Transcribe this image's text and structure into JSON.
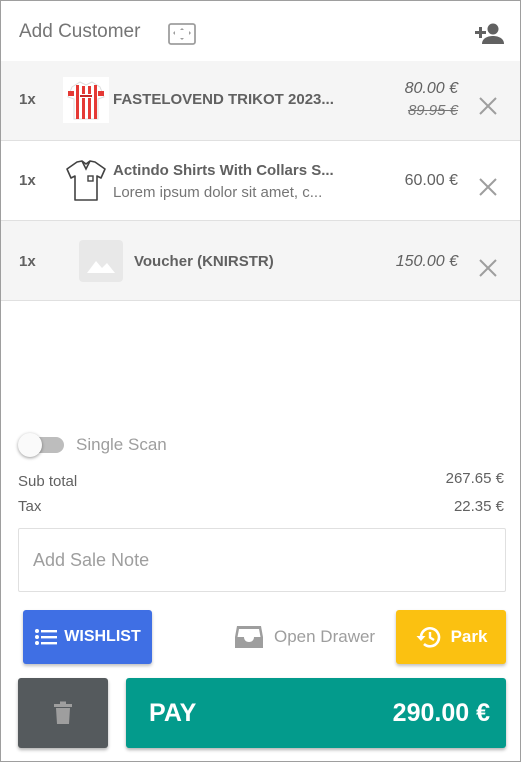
{
  "header": {
    "title": "Add Customer",
    "scan_icon": "barcode-scan-icon",
    "add_customer_icon": "person-add-icon"
  },
  "cart": {
    "items": [
      {
        "qty": "1x",
        "name": "FASTELOVEND TRIKOT 2023...",
        "description": "",
        "price": "80.00 €",
        "old_price": "89.95 €",
        "thumbnail": "red-white-striped-jersey",
        "remove_icon": "close-icon"
      },
      {
        "qty": "1x",
        "name": "Actindo Shirts With Collars S...",
        "description": "Lorem ipsum dolor sit amet, c...",
        "price": "60.00 €",
        "old_price": "",
        "thumbnail": "shirt-outline-icon",
        "remove_icon": "close-icon"
      },
      {
        "qty": "1x",
        "name": "Voucher (KNIRSTR)",
        "description": "",
        "price": "150.00 €",
        "old_price": "",
        "thumbnail": "image-placeholder-icon",
        "remove_icon": "close-icon"
      }
    ]
  },
  "single_scan": {
    "label": "Single Scan",
    "enabled": false
  },
  "summary": {
    "subtotal_label": "Sub total",
    "subtotal_value": "267.65 €",
    "tax_label": "Tax",
    "tax_value": "22.35 €"
  },
  "sale_note": {
    "placeholder": "Add Sale Note",
    "value": ""
  },
  "actions": {
    "wishlist_label": "WISHLIST",
    "open_drawer_label": "Open Drawer",
    "park_label": "Park",
    "pay_label": "PAY",
    "pay_total": "290.00 €"
  },
  "colors": {
    "wishlist": "#3f6fe4",
    "park": "#fbc111",
    "pay": "#039b8c",
    "trash": "#555a5d",
    "shaded_row": "#f5f5f5"
  }
}
